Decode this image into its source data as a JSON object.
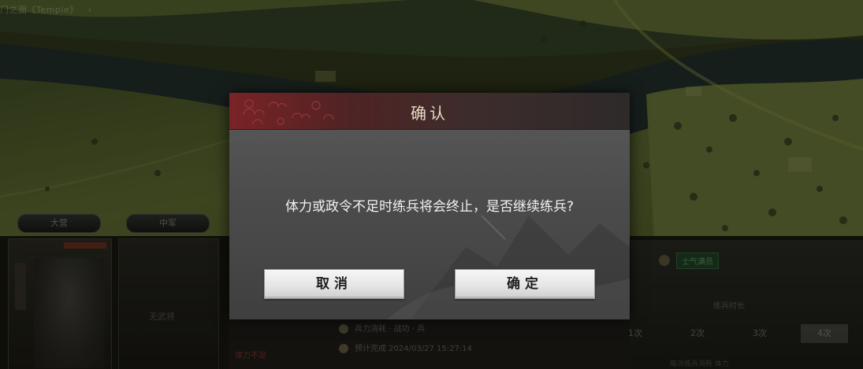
{
  "breadcrumb": {
    "text": "门之面《Temple》",
    "chevron": "›"
  },
  "map": {
    "description_hidden": true
  },
  "hero_panel": {
    "tab_left": "大营",
    "tab_right": "中军",
    "slot2_text": "无武将"
  },
  "info_panel": {
    "rows": [
      {
        "icon": "gold-coin-icon",
        "text": "兵力消耗 · 战功 · 兵"
      },
      {
        "icon": "helmet-icon",
        "text": "预计完成 2024/03/27 15:27:14"
      }
    ],
    "red_text": "体力不足"
  },
  "right_panel": {
    "status_label": "士气满员",
    "duration_label": "练兵时长",
    "durations": [
      "1次",
      "2次",
      "3次",
      "4次"
    ],
    "active_duration_index": 3,
    "footnote": "每次练兵消耗 体力"
  },
  "dialog": {
    "title": "确认",
    "message": "体力或政令不足时练兵将会终止，是否继续练兵?",
    "cancel_label": "取消",
    "ok_label": "确定"
  },
  "colors": {
    "header_red": "#7a2325",
    "dialog_body": "#4c4c4c",
    "title_text": "#e8dcc4",
    "button_bg": "#e6e6e6"
  }
}
